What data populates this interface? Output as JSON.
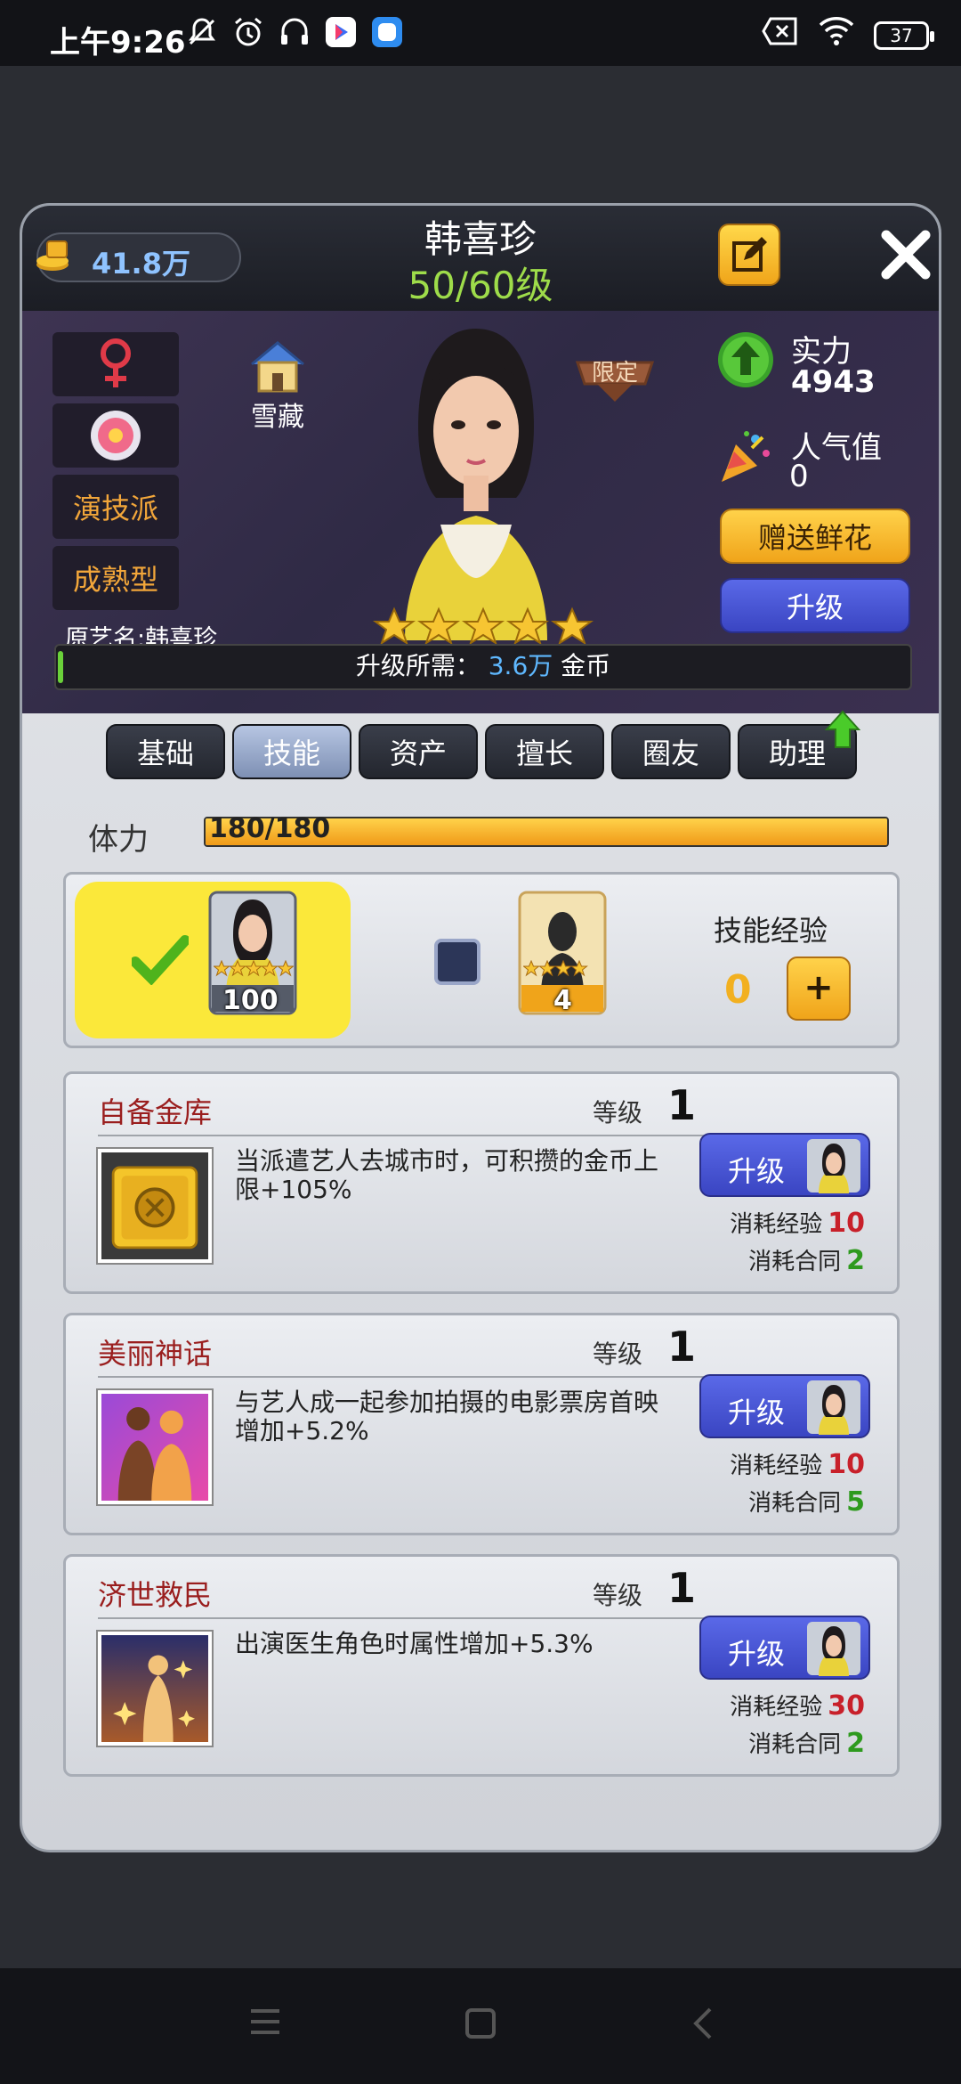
{
  "status_bar": {
    "time": "上午9:26",
    "battery": "37",
    "icons": [
      "mute-bell-icon",
      "alarm-icon",
      "headset-icon",
      "play-app-icon",
      "app-icon",
      "no-sim-icon",
      "wifi-icon",
      "battery-icon"
    ]
  },
  "header": {
    "gold": "41.8万",
    "name": "韩喜珍",
    "level": "50/60级",
    "edit_icon": "edit-icon",
    "close_icon": "close-icon"
  },
  "profile": {
    "gender_icon": "female-symbol-icon",
    "badge_icon": "flower-badge-icon",
    "tag1": "演技派",
    "tag2": "成熟型",
    "home_label": "雪藏",
    "original_name": "原艺名:韩喜珍",
    "limited": "限定",
    "stars": 5,
    "strength_label": "实力",
    "strength_value": "4943",
    "popularity_label": "人气值",
    "popularity_value": "0",
    "gift_button": "赠送鲜花",
    "upgrade_button": "升级",
    "upgrade_need_label": "升级所需：",
    "upgrade_need_value": "3.6万",
    "upgrade_need_unit": "金币"
  },
  "tabs": [
    {
      "label": "基础",
      "active": false
    },
    {
      "label": "技能",
      "active": true
    },
    {
      "label": "资产",
      "active": false
    },
    {
      "label": "擅长",
      "active": false
    },
    {
      "label": "圈友",
      "active": false
    },
    {
      "label": "助理",
      "active": false
    }
  ],
  "stamina": {
    "label": "体力",
    "value": "180/180",
    "fraction": 1.0
  },
  "skill_exp": {
    "card1_count": "100",
    "card2_count": "4",
    "title": "技能经验",
    "value": "0",
    "plus": "+"
  },
  "skills": [
    {
      "name": "自备金库",
      "level_label": "等级",
      "level": "1",
      "desc": "当派遣艺人去城市时，可积攒的金币上限+105%",
      "button": "升级",
      "cost_exp_label": "消耗经验",
      "cost_exp": "10",
      "cost_contract_label": "消耗合同",
      "cost_contract": "2",
      "icon": "safe-icon"
    },
    {
      "name": "美丽神话",
      "level_label": "等级",
      "level": "1",
      "desc": "与艺人成一起参加拍摄的电影票房首映增加+5.2%",
      "button": "升级",
      "cost_exp_label": "消耗经验",
      "cost_exp": "10",
      "cost_contract_label": "消耗合同",
      "cost_contract": "5",
      "icon": "two-women-icon"
    },
    {
      "name": "济世救民",
      "level_label": "等级",
      "level": "1",
      "desc": "出演医生角色时属性增加+5.3%",
      "button": "升级",
      "cost_exp_label": "消耗经验",
      "cost_exp": "30",
      "cost_contract_label": "消耗合同",
      "cost_contract": "2",
      "icon": "sparkle-figure-icon"
    }
  ],
  "nav": [
    "menu-icon",
    "home-icon",
    "back-icon"
  ]
}
